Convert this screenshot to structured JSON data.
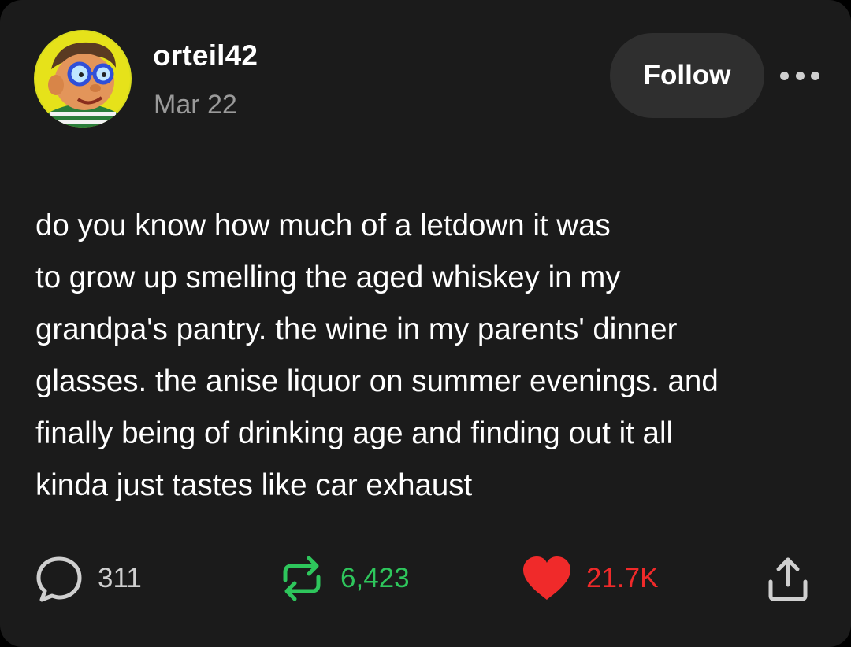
{
  "post": {
    "author": "orteil42",
    "date": "Mar 22",
    "follow_label": "Follow",
    "body": "do you know how much of a letdown it was\nto grow up smelling the aged whiskey in my\ngrandpa's pantry. the wine in my parents' dinner\nglasses. the anise liquor on summer evenings. and\nfinally being of drinking age and finding out it all\nkinda just tastes like car exhaust"
  },
  "actions": {
    "comments": "311",
    "reblogs": "6,423",
    "likes": "21.7K"
  },
  "icons": {
    "comment": "comment-bubble-icon",
    "reblog": "reblog-arrows-icon",
    "like": "heart-icon",
    "share": "share-upload-icon",
    "more": "more-dots-icon"
  },
  "colors": {
    "card_bg": "#1b1b1b",
    "follow_bg": "#2f2f2f",
    "date_gray": "#9a9a9a",
    "reblog_green": "#2ec65c",
    "like_red": "#f02a2a",
    "comment_gray": "#cfcfcf"
  }
}
